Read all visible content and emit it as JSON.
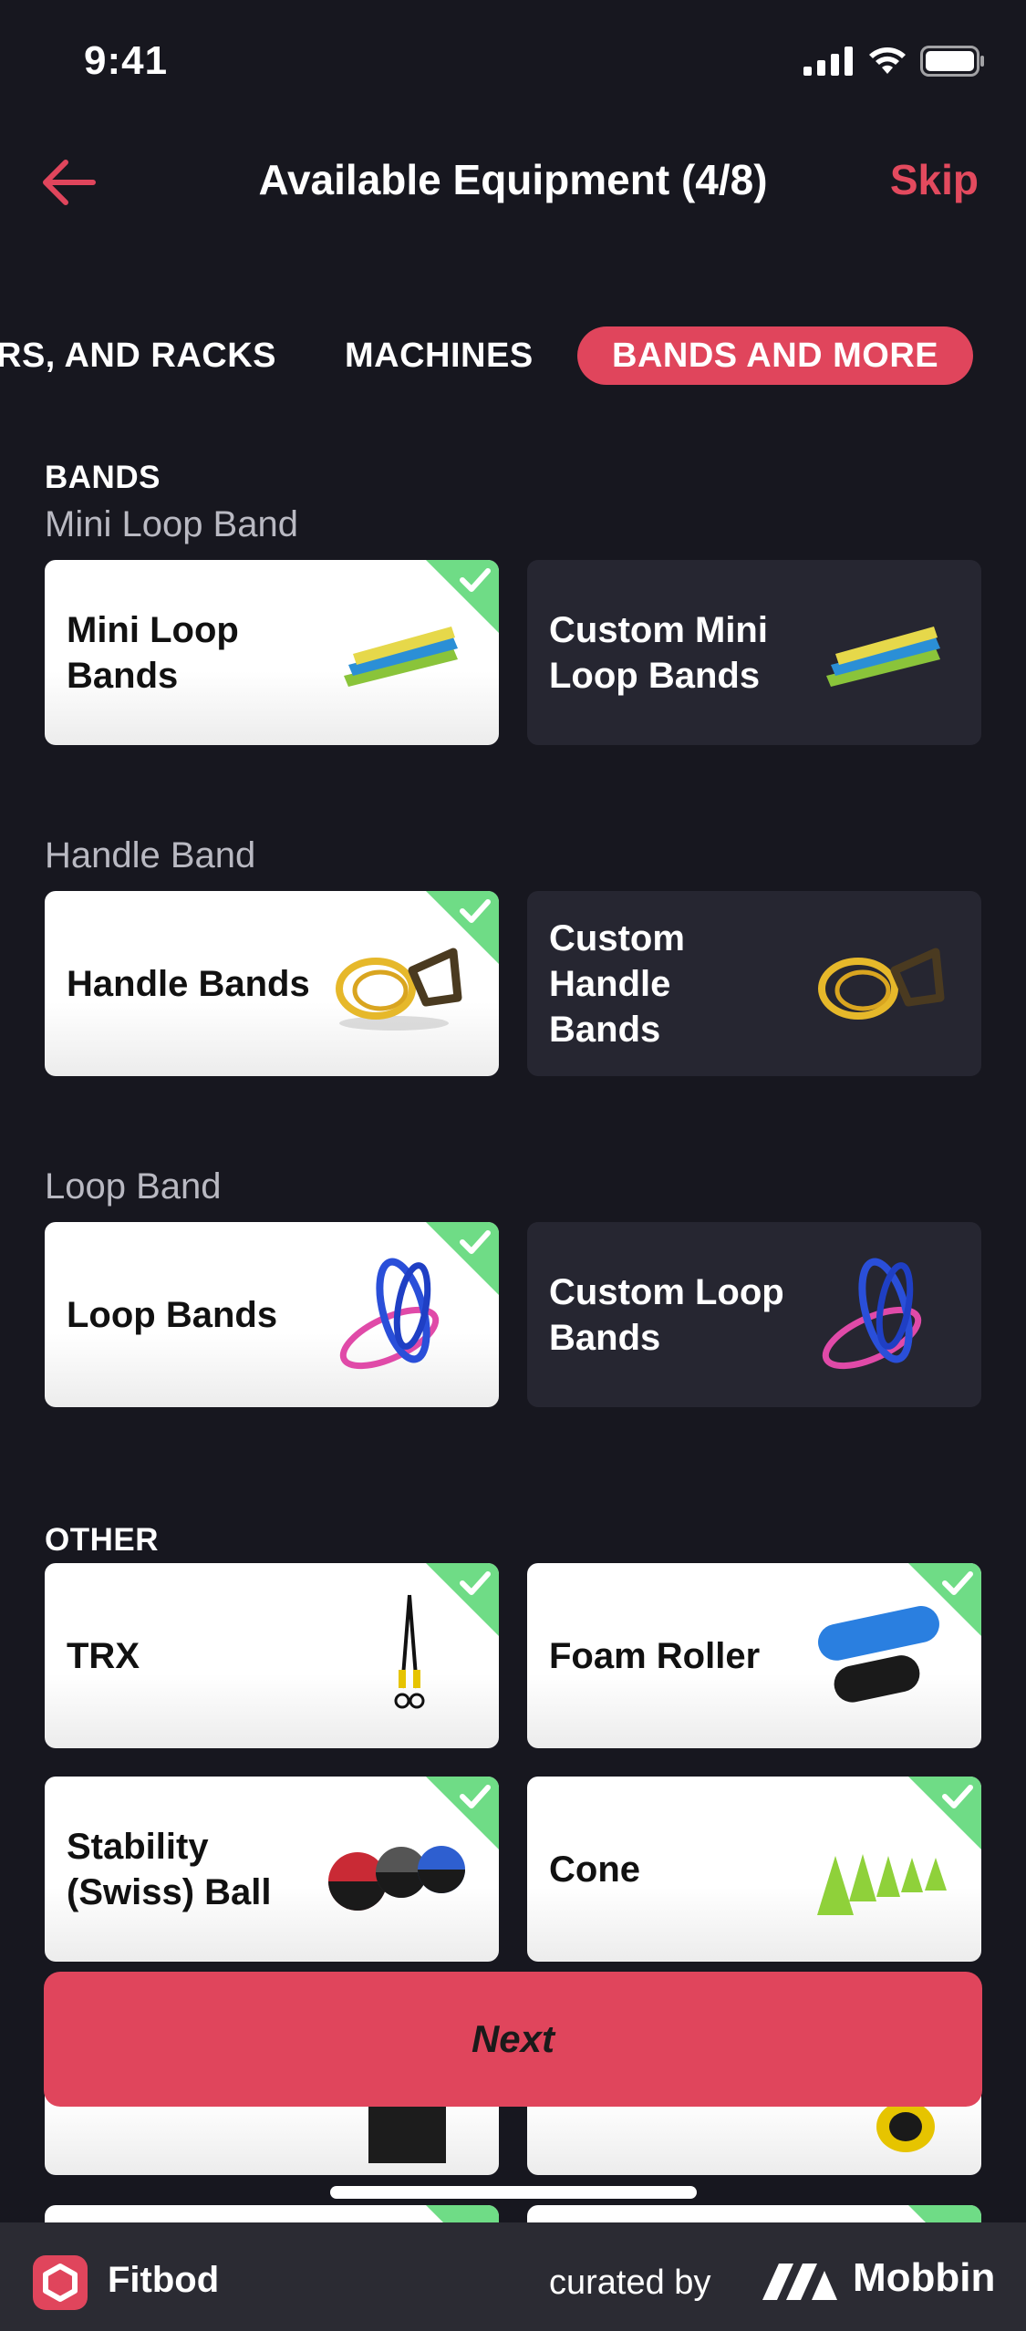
{
  "status_bar": {
    "time": "9:41"
  },
  "header": {
    "title": "Available Equipment (4/8)",
    "skip_label": "Skip"
  },
  "tabs": [
    {
      "label": "RS, AND RACKS",
      "active": false
    },
    {
      "label": "MACHINES",
      "active": false
    },
    {
      "label": "BANDS AND MORE",
      "active": true
    }
  ],
  "sections": {
    "bands": {
      "heading": "BANDS",
      "groups": [
        {
          "subheading": "Mini Loop Band",
          "cards": [
            {
              "label": "Mini Loop Bands",
              "selected": true,
              "icon": "mini-loop-bands-image"
            },
            {
              "label": "Custom Mini Loop Bands",
              "selected": false,
              "icon": "mini-loop-bands-image"
            }
          ]
        },
        {
          "subheading": "Handle Band",
          "cards": [
            {
              "label": "Handle Bands",
              "selected": true,
              "icon": "handle-bands-image"
            },
            {
              "label": "Custom Handle Bands",
              "selected": false,
              "icon": "handle-bands-image"
            }
          ]
        },
        {
          "subheading": "Loop Band",
          "cards": [
            {
              "label": "Loop Bands",
              "selected": true,
              "icon": "loop-bands-image"
            },
            {
              "label": "Custom Loop Bands",
              "selected": false,
              "icon": "loop-bands-image"
            }
          ]
        }
      ]
    },
    "other": {
      "heading": "OTHER",
      "cards": [
        {
          "label": "TRX",
          "selected": true,
          "icon": "trx-image"
        },
        {
          "label": "Foam Roller",
          "selected": true,
          "icon": "foam-roller-image"
        },
        {
          "label": "Stability (Swiss) Ball",
          "selected": true,
          "icon": "stability-ball-image"
        },
        {
          "label": "Cone",
          "selected": true,
          "icon": "cone-image"
        }
      ]
    }
  },
  "next_label": "Next",
  "footer": {
    "app_name": "Fitbod",
    "curated_by": "curated by",
    "brand": "Mobbin"
  },
  "colors": {
    "background": "#17171f",
    "accent": "#e0455c",
    "check_green": "#6fdc86",
    "card_dark": "#262631",
    "card_light": "#ffffff"
  }
}
